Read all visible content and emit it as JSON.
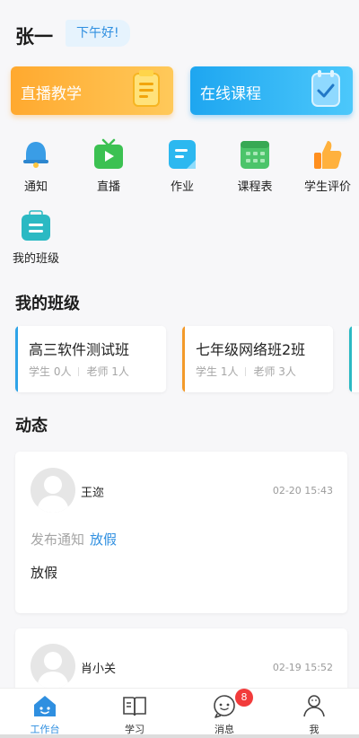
{
  "header": {
    "username": "张一",
    "greeting": "下午好!"
  },
  "features": [
    {
      "label": "直播教学",
      "icon": "live-board-icon",
      "color": "#ffb13d"
    },
    {
      "label": "在线课程",
      "icon": "online-course-icon",
      "color": "#2eb3f5"
    }
  ],
  "menu": [
    {
      "label": "通知",
      "icon": "bell-icon",
      "color": "#3a9de6"
    },
    {
      "label": "直播",
      "icon": "tv-play-icon",
      "color": "#3cc152"
    },
    {
      "label": "作业",
      "icon": "homework-icon",
      "color": "#2cb8f0"
    },
    {
      "label": "课程表",
      "icon": "calendar-icon",
      "color": "#4cc46a"
    },
    {
      "label": "学生评价",
      "icon": "thumbs-up-icon",
      "color": "#ffa733"
    },
    {
      "label": "我的班级",
      "icon": "class-board-icon",
      "color": "#2bb9c3"
    }
  ],
  "sections": {
    "classes_title": "我的班级",
    "feed_title": "动态"
  },
  "classes": [
    {
      "name": "高三软件测试班",
      "students": "学生 0人",
      "teachers": "老师 1人",
      "accent": "#2fa4e8"
    },
    {
      "name": "七年级网络班2班",
      "students": "学生 1人",
      "teachers": "老师 3人",
      "accent": "#f39a2a"
    }
  ],
  "feed": [
    {
      "author": "王迩",
      "time": "02-20 15:43",
      "type": "发布通知",
      "title": "放假",
      "body": "放假"
    },
    {
      "author": "肖小关",
      "time": "02-19 15:52"
    }
  ],
  "tabs": [
    {
      "label": "工作台",
      "icon": "home-icon",
      "active": true
    },
    {
      "label": "学习",
      "icon": "book-icon"
    },
    {
      "label": "消息",
      "icon": "message-icon"
    },
    {
      "label": "我",
      "icon": "person-icon"
    }
  ],
  "messages_badge": "8",
  "colors": {
    "primary": "#2f8fe0",
    "badge": "#f23b3b"
  }
}
